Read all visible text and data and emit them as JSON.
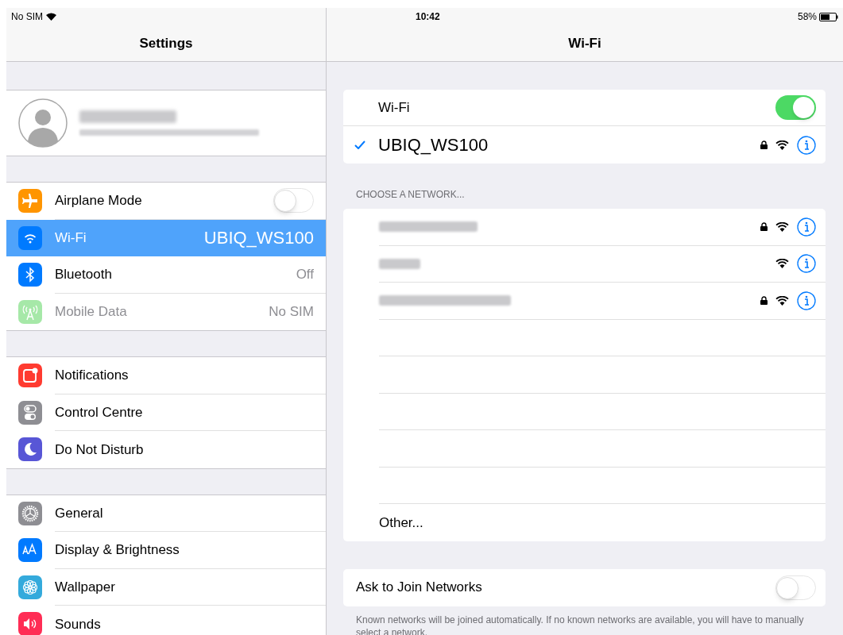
{
  "status_bar": {
    "carrier": "No SIM",
    "time": "10:42",
    "battery": "58%"
  },
  "sidebar": {
    "title": "Settings",
    "profile": {
      "redacted": true
    },
    "groups": [
      [
        {
          "label": "Airplane Mode",
          "kind": "toggle",
          "on": false,
          "selected": false,
          "disabled": false,
          "color": "#ff9500"
        },
        {
          "label": "Wi-Fi",
          "kind": "value",
          "value": "UBIQ_WS100",
          "selected": true,
          "disabled": false,
          "color": "#007aff"
        },
        {
          "label": "Bluetooth",
          "kind": "value",
          "value": "Off",
          "selected": false,
          "disabled": false,
          "color": "#007aff"
        },
        {
          "label": "Mobile Data",
          "kind": "value",
          "value": "No SIM",
          "selected": false,
          "disabled": true,
          "color": "#a6e8a8"
        }
      ],
      [
        {
          "label": "Notifications",
          "kind": "plain",
          "selected": false,
          "disabled": false,
          "color": "#ff3b30"
        },
        {
          "label": "Control Centre",
          "kind": "plain",
          "selected": false,
          "disabled": false,
          "color": "#8e8e93"
        },
        {
          "label": "Do Not Disturb",
          "kind": "plain",
          "selected": false,
          "disabled": false,
          "color": "#5856d6"
        }
      ],
      [
        {
          "label": "General",
          "kind": "plain",
          "selected": false,
          "disabled": false,
          "color": "#8e8e93"
        },
        {
          "label": "Display & Brightness",
          "kind": "plain",
          "selected": false,
          "disabled": false,
          "color": "#007aff"
        },
        {
          "label": "Wallpaper",
          "kind": "plain",
          "selected": false,
          "disabled": false,
          "color": "#34aadc"
        },
        {
          "label": "Sounds",
          "kind": "plain",
          "selected": false,
          "disabled": false,
          "color": "#ff2d55"
        }
      ]
    ]
  },
  "detail": {
    "title": "Wi-Fi",
    "wifi": {
      "label": "Wi-Fi",
      "on": true
    },
    "connected": {
      "name": "UBIQ_WS100",
      "checked": true,
      "locked": true
    },
    "section_header": "CHOOSE A NETWORK...",
    "networks": [
      {
        "redacted": true,
        "locked": true
      },
      {
        "redacted": true,
        "locked": false
      },
      {
        "redacted": true,
        "locked": true
      }
    ],
    "other": "Other...",
    "ask_to_join": {
      "label": "Ask to Join Networks",
      "on": false
    },
    "footer": "Known networks will be joined automatically. If no known networks are available, you will have to manually select a network."
  }
}
